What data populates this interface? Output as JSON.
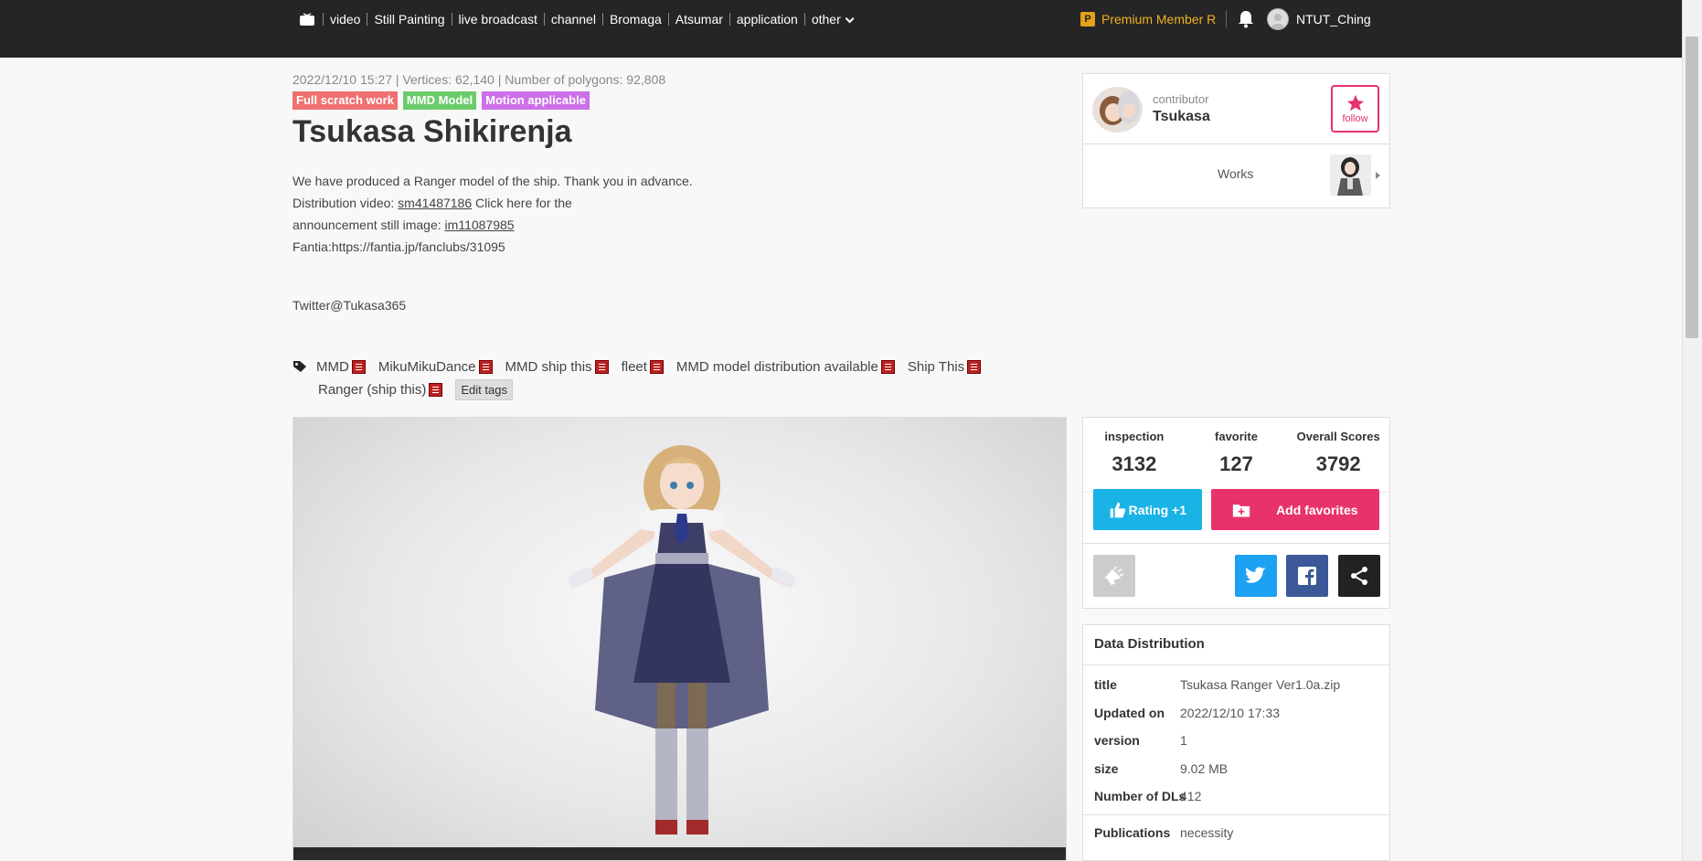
{
  "nav": {
    "items": [
      "video",
      "Still Painting",
      "live broadcast",
      "channel",
      "Bromaga",
      "Atsumar",
      "application",
      "other"
    ],
    "premium_badge": "P",
    "premium_label": "Premium Member Re|",
    "username": "NTUT_Ching"
  },
  "work": {
    "meta": "2022/12/10 15:27 | Vertices: 62,140 | Number of polygons: 92,808",
    "badges": [
      {
        "label": "Full scratch work",
        "color": "#f07070"
      },
      {
        "label": "MMD Model",
        "color": "#6ccc6c"
      },
      {
        "label": "Motion applicable",
        "color": "#cc70e8"
      }
    ],
    "title": "Tsukasa Shikirenja",
    "desc_line1": "We have produced a Ranger model of the ship. Thank you in advance.",
    "desc_line2_pre": "Distribution video: ",
    "desc_video_link": "sm41487186",
    "desc_line2_post": " Click here for the",
    "desc_line3_pre": "announcement still image: ",
    "desc_image_link": "im11087985",
    "desc_line4": "Fantia:https://fantia.jp/fanclubs/31095",
    "twitter": "Twitter@Tukasa365"
  },
  "tags": {
    "row1": [
      "MMD",
      "MikuMikuDance",
      "MMD ship this",
      "fleet",
      "MMD model distribution available",
      "Ship This"
    ],
    "row2": [
      "Ranger (ship this)"
    ],
    "edit_label": "Edit tags"
  },
  "contributor": {
    "label": "contributor",
    "name": "Tsukasa",
    "follow_label": "follow",
    "works_label": "Works"
  },
  "stats": {
    "inspection_label": "inspection",
    "inspection_value": "3132",
    "favorite_label": "favorite",
    "favorite_value": "127",
    "score_label": "Overall Scores",
    "score_value": "3792",
    "rate_button": "Rating +1",
    "fav_button": "Add favorites"
  },
  "distribution": {
    "heading": "Data Distribution",
    "rows": [
      {
        "k": "title",
        "v": "Tsukasa Ranger Ver1.0a.zip"
      },
      {
        "k": "Updated on",
        "v": "2022/12/10 17:33"
      },
      {
        "k": "version",
        "v": "1"
      },
      {
        "k": "size",
        "v": "9.02 MB"
      },
      {
        "k": "Number of DLs",
        "v": "412"
      }
    ],
    "pub_key": "Publications",
    "pub_val": "necessity"
  },
  "colors": {
    "topbar": "#252525",
    "accent_pink": "#e8336a",
    "accent_blue": "#19b3e6",
    "twitter": "#1da1f2",
    "facebook": "#3b5998"
  }
}
